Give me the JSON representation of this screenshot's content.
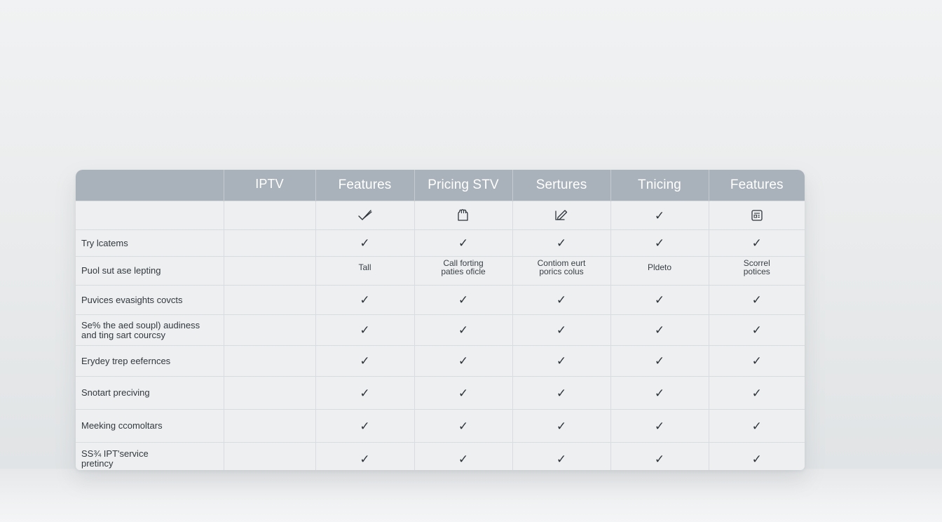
{
  "table": {
    "headers": [
      "",
      "IPTV",
      "Features",
      "Pricing STV",
      "Sertures",
      "Tnicing",
      "Features"
    ],
    "icon_row": [
      "",
      "",
      "check-scribble-icon",
      "hand-icon",
      "edit-pencil-icon",
      "check-icon",
      "document-icon"
    ],
    "check_mark": "✓",
    "rows": [
      {
        "label": "Try lcatems",
        "cells": [
          "",
          "check",
          "check",
          "check",
          "check",
          "check"
        ]
      },
      {
        "label": "Puol sut ase lepting",
        "cells": [
          "",
          "Tall",
          "Call forting\npaties oficle",
          "Contiom eurt\nporics colus",
          "Pldeto",
          "Scorrel\npotices"
        ]
      },
      {
        "label": "Puvices evasights covcts",
        "cells": [
          "",
          "check",
          "check",
          "check",
          "check",
          "check"
        ]
      },
      {
        "label": "Se% the aed soupl) audiness\nand ting sart courcsy",
        "cells": [
          "",
          "check",
          "check",
          "check",
          "check",
          "check"
        ]
      },
      {
        "label": "Erydey trep eefernces",
        "cells": [
          "",
          "check",
          "check",
          "check",
          "check",
          "check"
        ]
      },
      {
        "label": "Snotart preciving",
        "cells": [
          "",
          "check",
          "check",
          "check",
          "check",
          "check"
        ]
      },
      {
        "label": "Meeking ccomoltars",
        "cells": [
          "",
          "check",
          "check",
          "check",
          "check",
          "check"
        ]
      },
      {
        "label": "SS¾ IPT'service\npretincy",
        "cells": [
          "",
          "check",
          "check",
          "check",
          "check",
          "check"
        ]
      }
    ]
  },
  "colors": {
    "header_bg": "#a9b2ba",
    "header_text": "#ffffff",
    "card_bg": "#edeff1",
    "grid_line": "#d8dcdf",
    "text": "#33383d"
  }
}
